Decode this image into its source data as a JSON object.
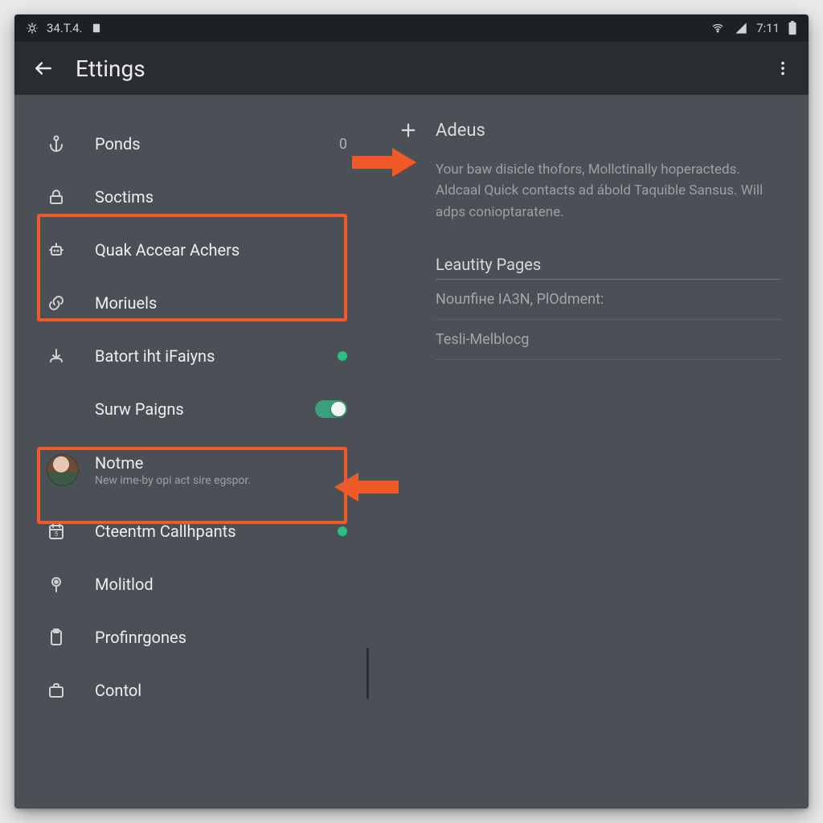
{
  "statusbar": {
    "left_text": "34.T.4.",
    "time": "7:11"
  },
  "appbar": {
    "title": "Ettings"
  },
  "sidebar": {
    "items": [
      {
        "icon": "anchor",
        "label": "Ponds",
        "trailing_text": "0"
      },
      {
        "icon": "lock",
        "label": "Soctims"
      },
      {
        "icon": "robot",
        "label": "Quak Accear Achers"
      },
      {
        "icon": "link",
        "label": "Moriuels"
      },
      {
        "icon": "download",
        "label": "Batort iht iFaiyns",
        "dot": true
      },
      {
        "icon": "",
        "label": "Surw Paigns",
        "switch": true
      },
      {
        "icon": "avatar",
        "label": "Notme",
        "sublabel": "New ime-by opi act sire egspor."
      },
      {
        "icon": "calendar",
        "label": "Cteentm Callhpants",
        "dot": true
      },
      {
        "icon": "pin",
        "label": "Molitlod"
      },
      {
        "icon": "clipboard",
        "label": "Profinrgones"
      },
      {
        "icon": "briefcase",
        "label": "Contol"
      }
    ]
  },
  "main": {
    "add_label": "Adeus",
    "description": "Your baw disicle thofors, Mollctinally hoperacteds. Aldcaal Quick contacts ad ábold Taquible Sansus. Will adps conioptaratene.",
    "section_title": "Leautity Pages",
    "rows": [
      {
        "label": "Nouлfiнe IA3N, PlOdment:"
      },
      {
        "label": "Tesli-Melblocg"
      }
    ]
  },
  "colors": {
    "highlight": "#f05a28",
    "accent": "#2bbf84"
  }
}
